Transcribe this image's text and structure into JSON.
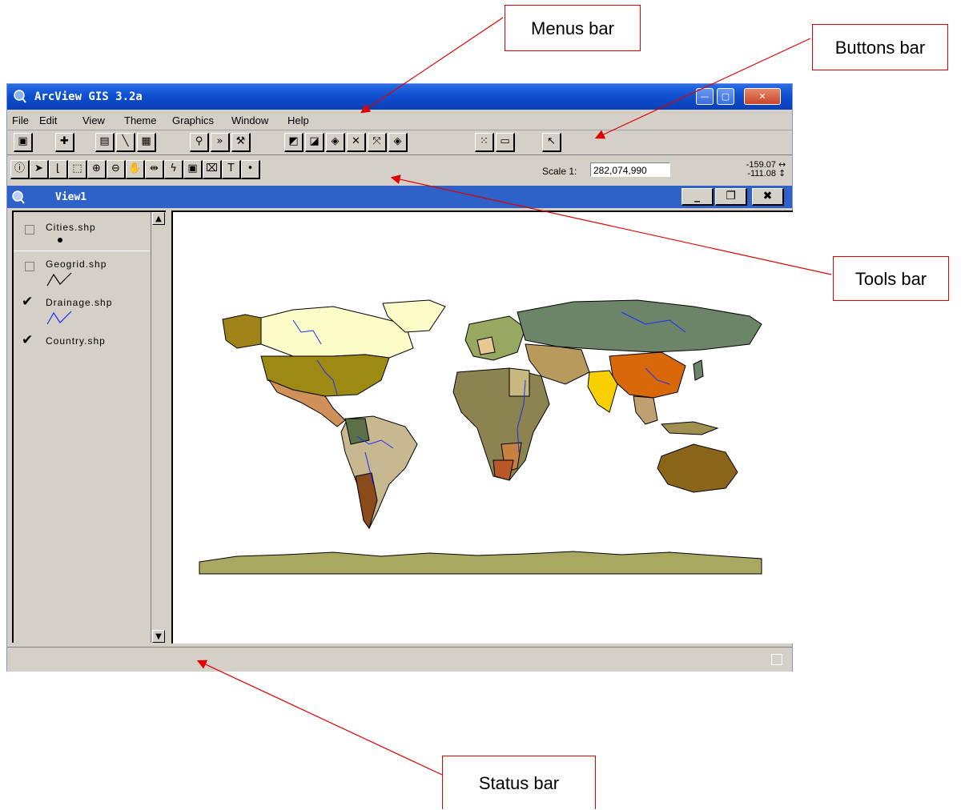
{
  "window": {
    "title": "ArcView GIS 3.2a"
  },
  "menu": [
    "File",
    "Edit",
    "View",
    "Theme",
    "Graphics",
    "Window",
    "Help"
  ],
  "buttons_bar": {
    "icons": [
      "save-icon",
      "add-theme-icon",
      "theme-properties-icon",
      "edit-legend-icon",
      "open-table-icon",
      "find-icon",
      "locate-address-icon",
      "query-builder-icon",
      "zoom-full-extent-icon",
      "zoom-active-themes-icon",
      "zoom-selected-icon",
      "zoom-in-fixed-icon",
      "zoom-out-fixed-icon",
      "zoom-previous-icon",
      "select-none-icon",
      "layout-icon",
      "help-icon"
    ]
  },
  "tools_bar": {
    "icons": [
      "identify-icon",
      "pointer-icon",
      "vertex-edit-icon",
      "select-feature-icon",
      "zoom-in-icon",
      "zoom-out-icon",
      "pan-icon",
      "measure-icon",
      "hotlink-icon",
      "area-of-interest-icon",
      "label-icon",
      "text-icon",
      "draw-point-icon"
    ],
    "text_tool_glyph": "T",
    "scale_label": "Scale 1:",
    "scale_value": "282,074,990",
    "coord_x": "-159.07",
    "coord_y": "-111.08"
  },
  "view": {
    "title": "View1",
    "buttons": {
      "minimize": "_",
      "restore": "❐",
      "close": "✖"
    }
  },
  "toc": {
    "layers": [
      {
        "name": "Cities.shp",
        "checked": false,
        "symbol": "point"
      },
      {
        "name": "Geogrid.shp",
        "checked": false,
        "symbol": "line"
      },
      {
        "name": "Drainage.shp",
        "checked": true,
        "symbol": "line-blue"
      },
      {
        "name": "Country.shp",
        "checked": true,
        "symbol": "polygon"
      }
    ]
  },
  "annotations": {
    "menus": "Menus bar",
    "buttons": "Buttons bar",
    "tools": "Tools bar",
    "status": "Status bar"
  },
  "colors": {
    "accent": "#e00000",
    "titlebar": "#0f4fcf",
    "view_titlebar": "#2e62c8",
    "drainage": "#1a2cff"
  }
}
